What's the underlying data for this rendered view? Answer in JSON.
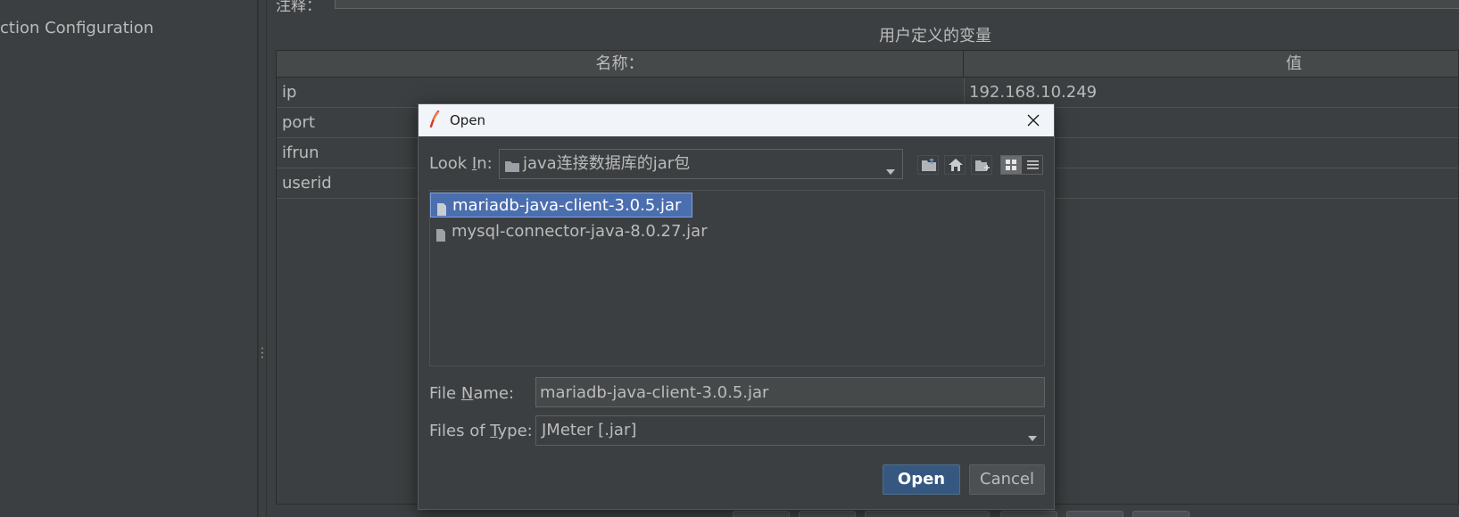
{
  "left_panel": {
    "tree_item": "ction Configuration"
  },
  "right_panel": {
    "top_field_label": "注释：",
    "table_title": "用户定义的变量",
    "columns": [
      "名称：",
      "值"
    ],
    "rows": [
      {
        "name": "ip",
        "value": "192.168.10.249"
      },
      {
        "name": "port",
        "value": ""
      },
      {
        "name": "ifrun",
        "value": ""
      },
      {
        "name": "userid",
        "value": ""
      }
    ]
  },
  "dialog": {
    "title": "Open",
    "look_in": {
      "label_pre": "Look ",
      "label_mnemonic": "I",
      "label_post": "n:",
      "value": "java连接数据库的jar包"
    },
    "toolbar_icons": [
      "up-folder-icon",
      "home-icon",
      "new-folder-icon",
      "list-view-icon",
      "details-view-icon"
    ],
    "files": [
      {
        "name": "mariadb-java-client-3.0.5.jar",
        "selected": true
      },
      {
        "name": "mysql-connector-java-8.0.27.jar",
        "selected": false
      }
    ],
    "file_name": {
      "label_pre": "File ",
      "label_mnemonic": "N",
      "label_post": "ame:",
      "value": "mariadb-java-client-3.0.5.jar"
    },
    "files_of_type": {
      "label_pre": "Files of ",
      "label_mnemonic": "T",
      "label_post": "ype:",
      "value": "JMeter [.jar]"
    },
    "open_button": "Open",
    "cancel_button": "Cancel"
  }
}
